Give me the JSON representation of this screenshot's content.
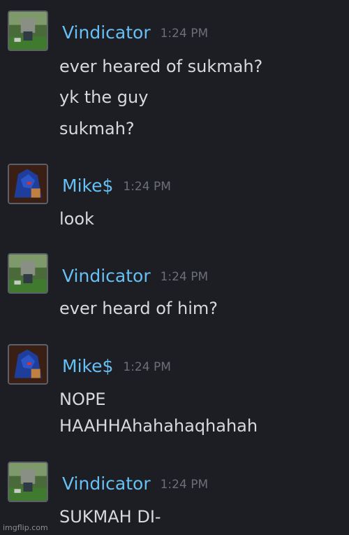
{
  "messages": [
    {
      "user": "Vindicator",
      "avatar_icon": "vindicator-avatar-icon",
      "time": "1:24 PM",
      "lines": [
        "ever heared of sukmah?",
        "yk the guy",
        "sukmah?"
      ]
    },
    {
      "user": "Mike$",
      "avatar_icon": "mike-avatar-icon",
      "time": "1:24 PM",
      "lines": [
        "look"
      ]
    },
    {
      "user": "Vindicator",
      "avatar_icon": "vindicator-avatar-icon",
      "time": "1:24 PM",
      "lines": [
        "ever heard of him?"
      ]
    },
    {
      "user": "Mike$",
      "avatar_icon": "mike-avatar-icon",
      "time": "1:24 PM",
      "lines": [
        "NOPE",
        "HAAHHAhahahaqhahah"
      ]
    },
    {
      "user": "Vindicator",
      "avatar_icon": "vindicator-avatar-icon",
      "time": "1:24 PM",
      "lines": [
        "SUKMAH DI-"
      ]
    }
  ],
  "watermark": "imgflip.com",
  "colors": {
    "background": "#1d1e23",
    "username": "#66c0f4",
    "timestamp": "#6c6f78",
    "message_text": "#d8d9dc"
  }
}
